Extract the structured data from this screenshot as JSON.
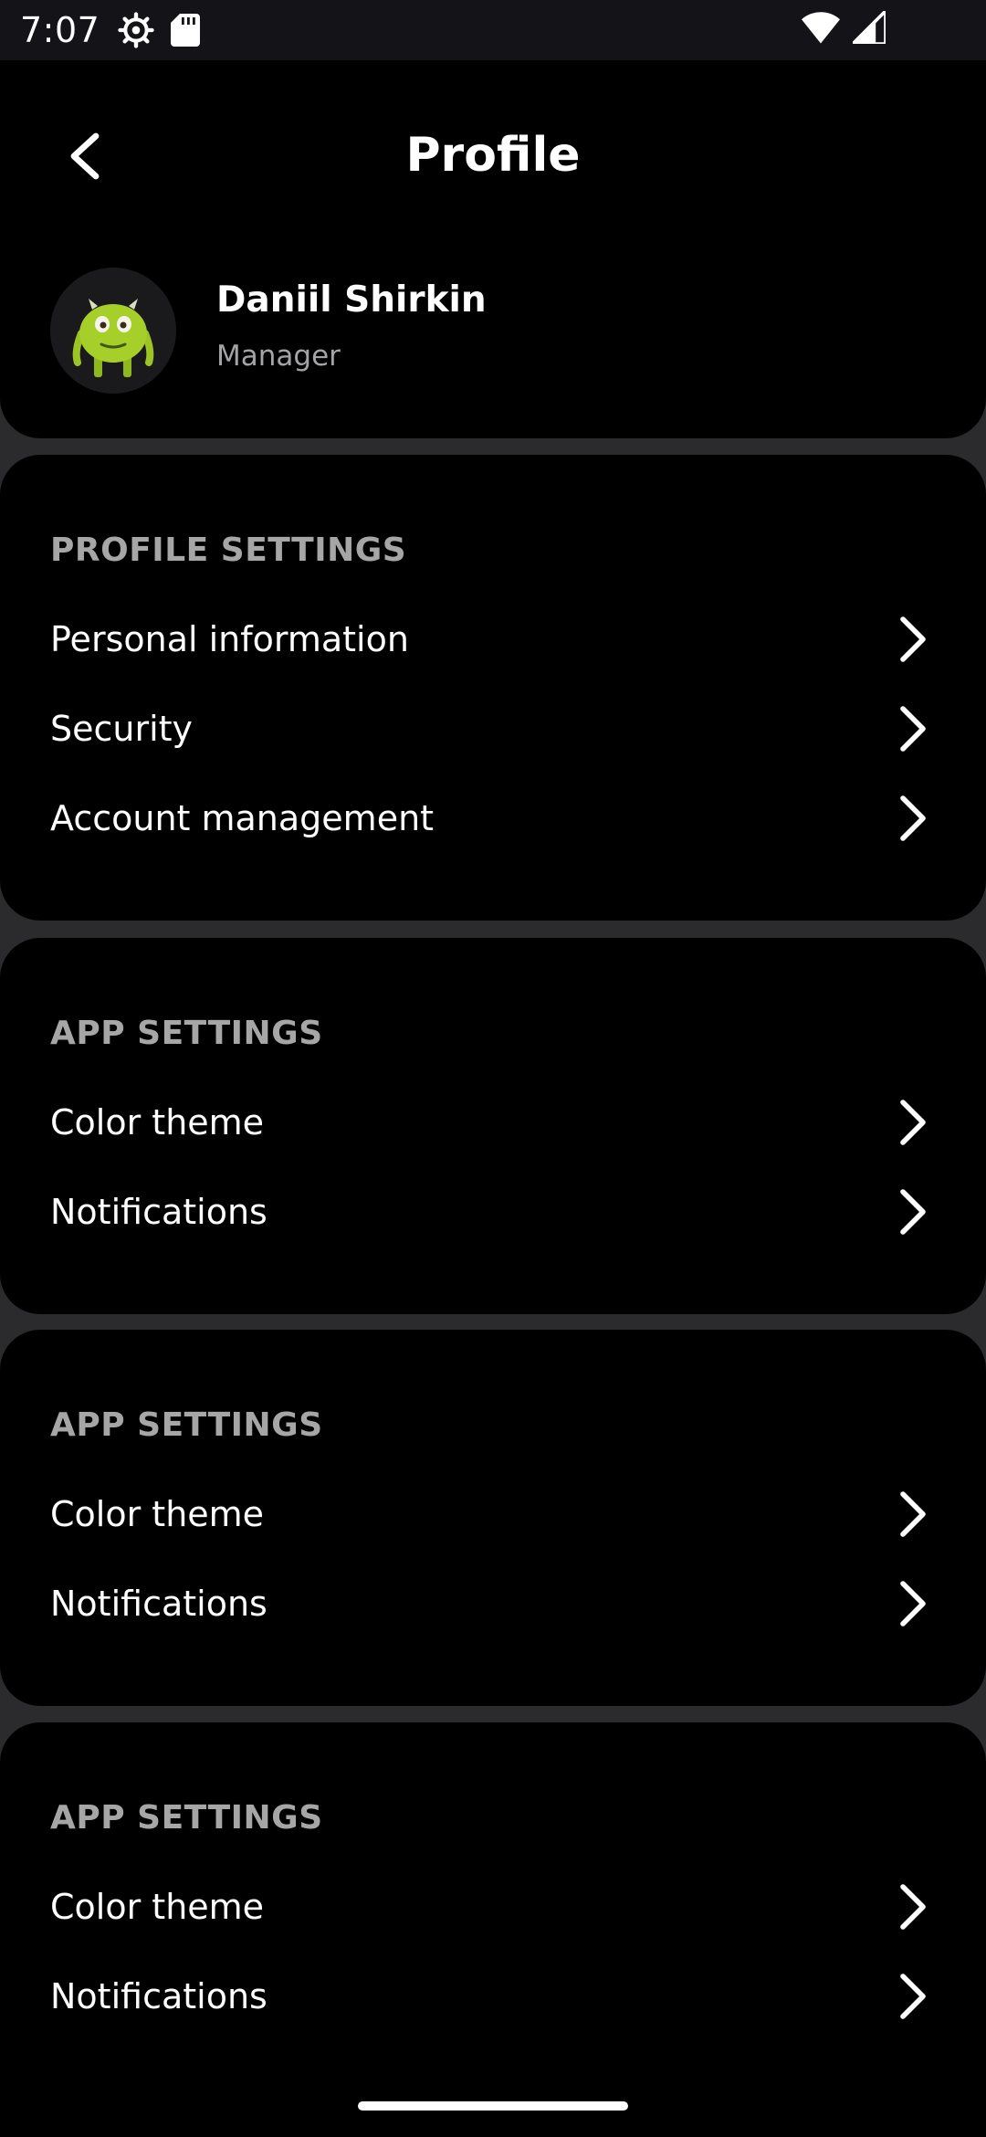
{
  "status_bar": {
    "time": "7:07",
    "icons": [
      "settings-gear-icon",
      "sd-card-icon",
      "wifi-icon",
      "cell-signal-icon"
    ]
  },
  "header": {
    "title": "Profile",
    "back_icon": "chevron-left-icon"
  },
  "user": {
    "name": "Daniil Shirkin",
    "role": "Manager"
  },
  "sections": [
    {
      "title": "PROFILE SETTINGS",
      "items": [
        {
          "label": "Personal information"
        },
        {
          "label": "Security"
        },
        {
          "label": "Account management"
        }
      ]
    },
    {
      "title": "APP SETTINGS",
      "items": [
        {
          "label": "Color theme"
        },
        {
          "label": "Notifications"
        }
      ]
    },
    {
      "title": "APP SETTINGS",
      "items": [
        {
          "label": "Color theme"
        },
        {
          "label": "Notifications"
        }
      ]
    },
    {
      "title": "APP SETTINGS",
      "items": [
        {
          "label": "Color theme"
        },
        {
          "label": "Notifications"
        }
      ]
    }
  ],
  "colors": {
    "background": "#2b2b2e",
    "card": "#000000",
    "section_title": "#a6a6a6",
    "secondary_text": "#a3a3a8"
  }
}
